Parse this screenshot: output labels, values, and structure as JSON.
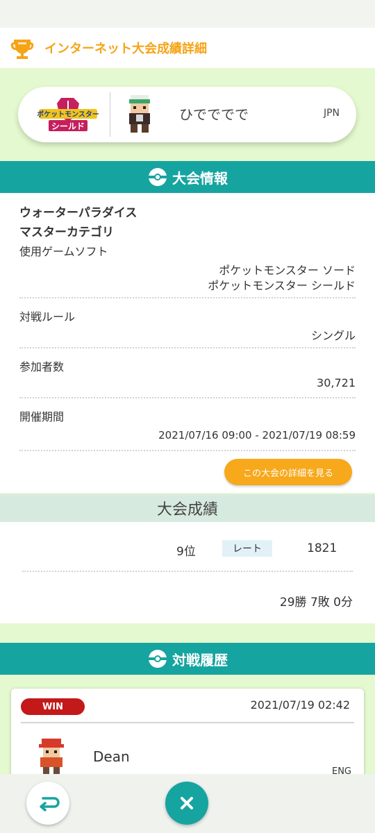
{
  "header": {
    "title": "インターネット大会成績詳細",
    "icon": "trophy-icon"
  },
  "profile": {
    "game_logo": "ポケットモンスター シールド",
    "player_name": "ひでででで",
    "region": "JPN"
  },
  "tournament_info": {
    "section_title": "大会情報",
    "name_line1": "ウォーターパラダイス",
    "name_line2": "マスターカテゴリ",
    "software_label": "使用ゲームソフト",
    "software_values": [
      "ポケットモンスター ソード",
      "ポケットモンスター シールド"
    ],
    "rule_label": "対戦ルール",
    "rule_value": "シングル",
    "participants_label": "参加者数",
    "participants_value": "30,721",
    "period_label": "開催期間",
    "period_value": "2021/07/16 09:00 - 2021/07/19 08:59",
    "details_button": "この大会の詳細を見る"
  },
  "results": {
    "section_title": "大会成績",
    "rank": "9位",
    "rate_label": "レート",
    "rate_value": "1821",
    "record": "29勝 7敗 0分"
  },
  "history": {
    "section_title": "対戦履歴",
    "battles": [
      {
        "result": "WIN",
        "datetime": "2021/07/19 02:42",
        "opponent": "Dean",
        "region": "ENG"
      }
    ]
  },
  "colors": {
    "accent": "#16a4a0",
    "orange": "#f5a417",
    "win": "#c31919",
    "background": "#e4f9cf"
  }
}
